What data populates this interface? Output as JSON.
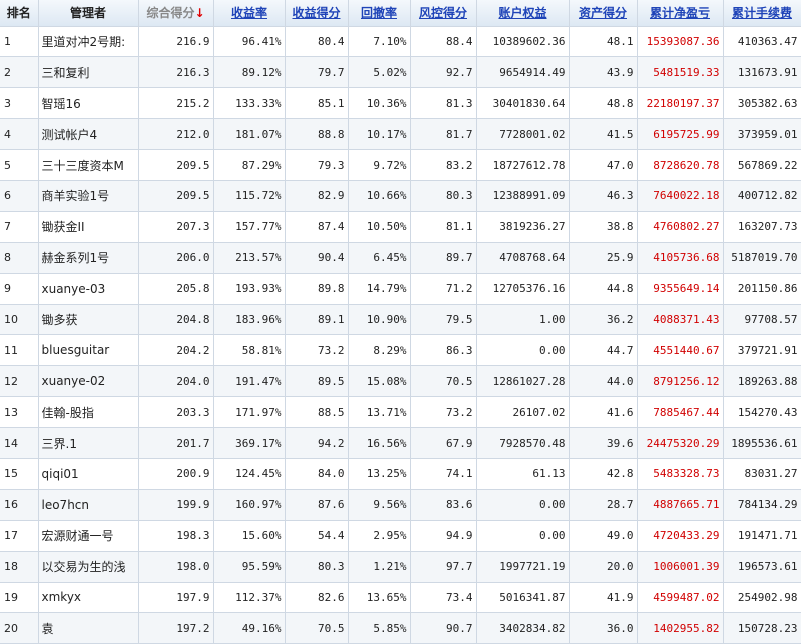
{
  "headers": {
    "rank": "排名",
    "manager": "管理者",
    "score": "综合得分",
    "sort_arrow": "↓",
    "return_rate": "收益率",
    "return_score": "收益得分",
    "drawdown": "回撤率",
    "risk_score": "风控得分",
    "equity": "账户权益",
    "asset_score": "资产得分",
    "net_pnl": "累计净盈亏",
    "fees": "累计手续费"
  },
  "rows": [
    {
      "rank": "1",
      "manager": "里道对冲2号期:",
      "score": "216.9",
      "return_rate": "96.41%",
      "return_score": "80.4",
      "drawdown": "7.10%",
      "risk_score": "88.4",
      "equity": "10389602.36",
      "asset_score": "48.1",
      "net_pnl": "15393087.36",
      "fees": "410363.47"
    },
    {
      "rank": "2",
      "manager": "三和复利",
      "score": "216.3",
      "return_rate": "89.12%",
      "return_score": "79.7",
      "drawdown": "5.02%",
      "risk_score": "92.7",
      "equity": "9654914.49",
      "asset_score": "43.9",
      "net_pnl": "5481519.33",
      "fees": "131673.91"
    },
    {
      "rank": "3",
      "manager": "智瑶16",
      "score": "215.2",
      "return_rate": "133.33%",
      "return_score": "85.1",
      "drawdown": "10.36%",
      "risk_score": "81.3",
      "equity": "30401830.64",
      "asset_score": "48.8",
      "net_pnl": "22180197.37",
      "fees": "305382.63"
    },
    {
      "rank": "4",
      "manager": "测试帐户4",
      "score": "212.0",
      "return_rate": "181.07%",
      "return_score": "88.8",
      "drawdown": "10.17%",
      "risk_score": "81.7",
      "equity": "7728001.02",
      "asset_score": "41.5",
      "net_pnl": "6195725.99",
      "fees": "373959.01"
    },
    {
      "rank": "5",
      "manager": "三十三度资本M",
      "score": "209.5",
      "return_rate": "87.29%",
      "return_score": "79.3",
      "drawdown": "9.72%",
      "risk_score": "83.2",
      "equity": "18727612.78",
      "asset_score": "47.0",
      "net_pnl": "8728620.78",
      "fees": "567869.22"
    },
    {
      "rank": "6",
      "manager": "商羊实验1号",
      "score": "209.5",
      "return_rate": "115.72%",
      "return_score": "82.9",
      "drawdown": "10.66%",
      "risk_score": "80.3",
      "equity": "12388991.09",
      "asset_score": "46.3",
      "net_pnl": "7640022.18",
      "fees": "400712.82"
    },
    {
      "rank": "7",
      "manager": "锄获金II",
      "score": "207.3",
      "return_rate": "157.77%",
      "return_score": "87.4",
      "drawdown": "10.50%",
      "risk_score": "81.1",
      "equity": "3819236.27",
      "asset_score": "38.8",
      "net_pnl": "4760802.27",
      "fees": "163207.73"
    },
    {
      "rank": "8",
      "manager": "赫金系列1号",
      "score": "206.0",
      "return_rate": "213.57%",
      "return_score": "90.4",
      "drawdown": "6.45%",
      "risk_score": "89.7",
      "equity": "4708768.64",
      "asset_score": "25.9",
      "net_pnl": "4105736.68",
      "fees": "5187019.70"
    },
    {
      "rank": "9",
      "manager": "xuanye-03",
      "score": "205.8",
      "return_rate": "193.93%",
      "return_score": "89.8",
      "drawdown": "14.79%",
      "risk_score": "71.2",
      "equity": "12705376.16",
      "asset_score": "44.8",
      "net_pnl": "9355649.14",
      "fees": "201150.86"
    },
    {
      "rank": "10",
      "manager": "锄多获",
      "score": "204.8",
      "return_rate": "183.96%",
      "return_score": "89.1",
      "drawdown": "10.90%",
      "risk_score": "79.5",
      "equity": "1.00",
      "asset_score": "36.2",
      "net_pnl": "4088371.43",
      "fees": "97708.57"
    },
    {
      "rank": "11",
      "manager": "bluesguitar",
      "score": "204.2",
      "return_rate": "58.81%",
      "return_score": "73.2",
      "drawdown": "8.29%",
      "risk_score": "86.3",
      "equity": "0.00",
      "asset_score": "44.7",
      "net_pnl": "4551440.67",
      "fees": "379721.91"
    },
    {
      "rank": "12",
      "manager": "xuanye-02",
      "score": "204.0",
      "return_rate": "191.47%",
      "return_score": "89.5",
      "drawdown": "15.08%",
      "risk_score": "70.5",
      "equity": "12861027.28",
      "asset_score": "44.0",
      "net_pnl": "8791256.12",
      "fees": "189263.88"
    },
    {
      "rank": "13",
      "manager": "佳翰-股指",
      "score": "203.3",
      "return_rate": "171.97%",
      "return_score": "88.5",
      "drawdown": "13.71%",
      "risk_score": "73.2",
      "equity": "26107.02",
      "asset_score": "41.6",
      "net_pnl": "7885467.44",
      "fees": "154270.43"
    },
    {
      "rank": "14",
      "manager": "三界.1",
      "score": "201.7",
      "return_rate": "369.17%",
      "return_score": "94.2",
      "drawdown": "16.56%",
      "risk_score": "67.9",
      "equity": "7928570.48",
      "asset_score": "39.6",
      "net_pnl": "24475320.29",
      "fees": "1895536.61"
    },
    {
      "rank": "15",
      "manager": "qiqi01",
      "score": "200.9",
      "return_rate": "124.45%",
      "return_score": "84.0",
      "drawdown": "13.25%",
      "risk_score": "74.1",
      "equity": "61.13",
      "asset_score": "42.8",
      "net_pnl": "5483328.73",
      "fees": "83031.27"
    },
    {
      "rank": "16",
      "manager": "leo7hcn",
      "score": "199.9",
      "return_rate": "160.97%",
      "return_score": "87.6",
      "drawdown": "9.56%",
      "risk_score": "83.6",
      "equity": "0.00",
      "asset_score": "28.7",
      "net_pnl": "4887665.71",
      "fees": "784134.29"
    },
    {
      "rank": "17",
      "manager": "宏源财通一号",
      "score": "198.3",
      "return_rate": "15.60%",
      "return_score": "54.4",
      "drawdown": "2.95%",
      "risk_score": "94.9",
      "equity": "0.00",
      "asset_score": "49.0",
      "net_pnl": "4720433.29",
      "fees": "191471.71"
    },
    {
      "rank": "18",
      "manager": "以交易为生的浅",
      "score": "198.0",
      "return_rate": "95.59%",
      "return_score": "80.3",
      "drawdown": "1.21%",
      "risk_score": "97.7",
      "equity": "1997721.19",
      "asset_score": "20.0",
      "net_pnl": "1006001.39",
      "fees": "196573.61"
    },
    {
      "rank": "19",
      "manager": "xmkyx",
      "score": "197.9",
      "return_rate": "112.37%",
      "return_score": "82.6",
      "drawdown": "13.65%",
      "risk_score": "73.4",
      "equity": "5016341.87",
      "asset_score": "41.9",
      "net_pnl": "4599487.02",
      "fees": "254902.98"
    },
    {
      "rank": "20",
      "manager": "袁",
      "score": "197.2",
      "return_rate": "49.16%",
      "return_score": "70.5",
      "drawdown": "5.85%",
      "risk_score": "90.7",
      "equity": "3402834.82",
      "asset_score": "36.0",
      "net_pnl": "1402955.82",
      "fees": "150728.23"
    }
  ],
  "colors": {
    "link": "#1f44b8",
    "pnl": "#d10000",
    "sort_arrow": "#e00000"
  }
}
